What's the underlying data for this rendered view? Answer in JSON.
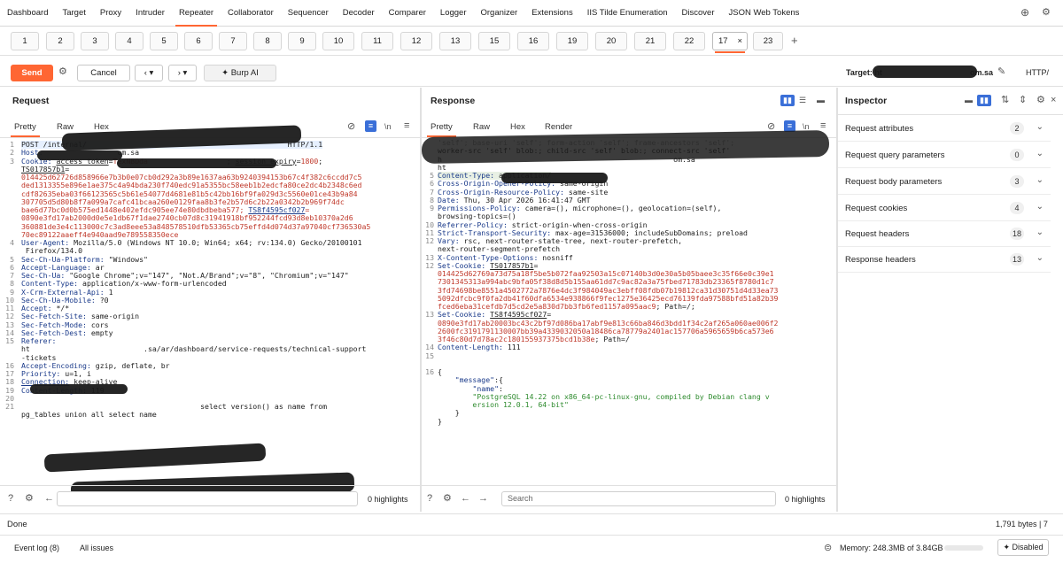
{
  "nav": [
    "Dashboard",
    "Target",
    "Proxy",
    "Intruder",
    "Repeater",
    "Collaborator",
    "Sequencer",
    "Decoder",
    "Comparer",
    "Logger",
    "Organizer",
    "Extensions",
    "IIS Tilde Enumeration",
    "Discover",
    "JSON Web Tokens"
  ],
  "tabs": [
    "1",
    "2",
    "3",
    "4",
    "5",
    "6",
    "7",
    "8",
    "9",
    "10",
    "11",
    "12",
    "13",
    "15",
    "16",
    "19",
    "20",
    "21",
    "22",
    "17",
    "23"
  ],
  "active_tab_close": "×",
  "add_tab": "+",
  "toolbar": {
    "send": "Send",
    "cancel": "Cancel",
    "burp_ai": "Burp AI",
    "target_label": "Target: ht",
    "target_suffix": "om.sa",
    "http": "HTTP/"
  },
  "request": {
    "title": "Request",
    "tabs": [
      "Pretty",
      "Raw",
      "Hex"
    ],
    "newline_toggle": "\\n",
    "search_placeholder": "",
    "highlights": "0 highlights"
  },
  "response": {
    "title": "Response",
    "tabs": [
      "Pretty",
      "Raw",
      "Hex",
      "Render"
    ],
    "newline_toggle": "\\n",
    "search_placeholder": "Search",
    "highlights": "0 highlights"
  },
  "inspector": {
    "title": "Inspector",
    "rows": [
      {
        "label": "Request attributes",
        "count": "2"
      },
      {
        "label": "Request query parameters",
        "count": "0"
      },
      {
        "label": "Request body parameters",
        "count": "3"
      },
      {
        "label": "Request cookies",
        "count": "4"
      },
      {
        "label": "Request headers",
        "count": "18"
      },
      {
        "label": "Response headers",
        "count": "13"
      }
    ]
  },
  "status": {
    "done": "Done",
    "bytes": "1,791 bytes | 7",
    "event_log": "Event log (8)",
    "all_issues": "All issues",
    "memory": "Memory: 248.3MB of 3.84GB",
    "disabled": "Disabled"
  },
  "colors": {
    "accent": "#ff6633",
    "header_key": "#1a3a8a",
    "cookie_value": "#c0392b",
    "json_string": "#2e8b2e"
  }
}
